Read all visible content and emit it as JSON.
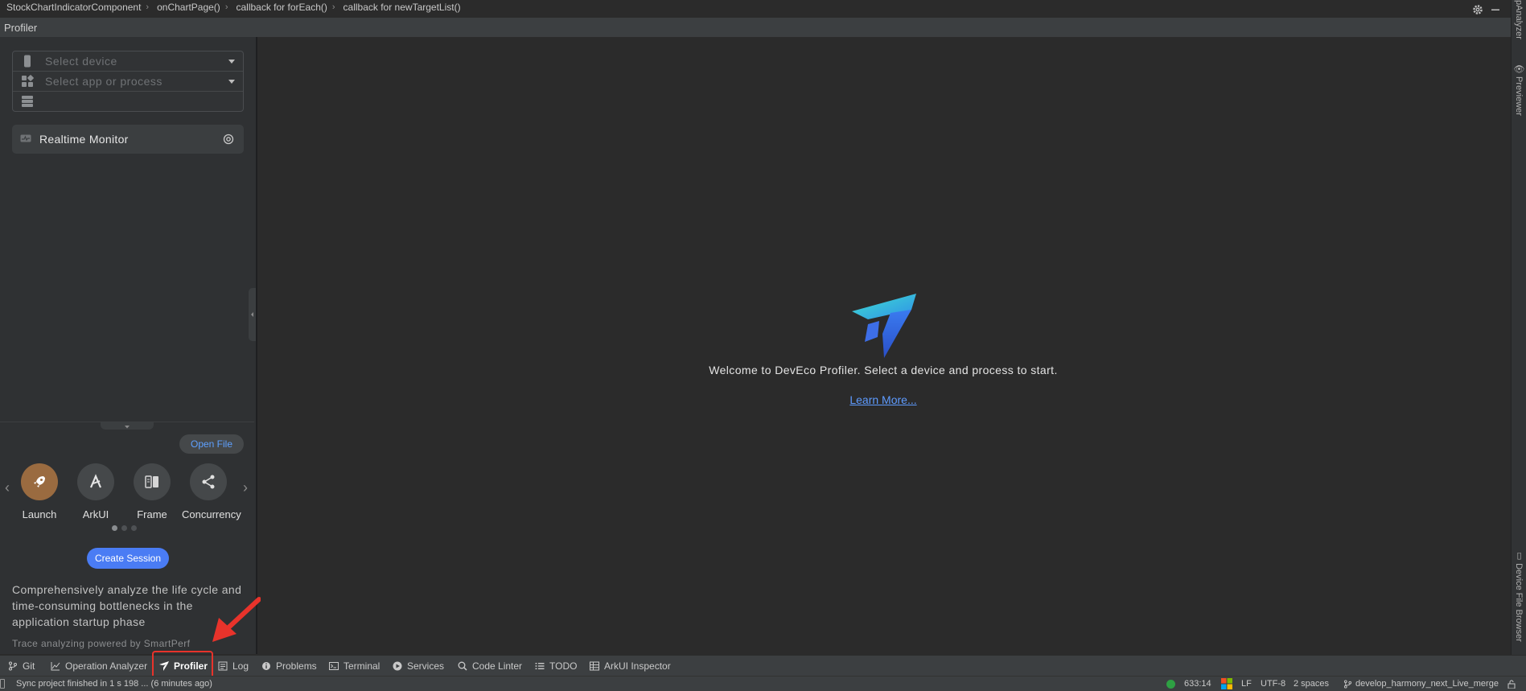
{
  "breadcrumb": [
    "StockChartIndicatorComponent",
    "onChartPage()",
    "callback for forEach()",
    "callback for newTargetList()"
  ],
  "toolwindow": {
    "title": "Profiler"
  },
  "selectors": {
    "device_placeholder": "Select device",
    "process_placeholder": "Select app or process"
  },
  "realtime_monitor": "Realtime Monitor",
  "open_file": "Open File",
  "tools": [
    {
      "label": "Launch",
      "icon": "rocket-icon"
    },
    {
      "label": "ArkUI",
      "icon": "arkui-icon"
    },
    {
      "label": "Frame",
      "icon": "frame-icon"
    },
    {
      "label": "Concurrency",
      "icon": "concurrency-icon"
    }
  ],
  "create_session": "Create Session",
  "description": "Comprehensively analyze the life cycle and time-consuming bottlenecks in the application startup phase",
  "powered_by": "Trace analyzing powered by SmartPerf",
  "welcome": {
    "text": "Welcome to DevEco Profiler. Select a device and process to start.",
    "learn_more": "Learn More..."
  },
  "right_stripe": {
    "top_cut": "pAnalyzer",
    "previewer": "Previewer",
    "device_file_browser": "Device File Browser"
  },
  "bottom_tabs": [
    "Git",
    "Operation Analyzer",
    "Profiler",
    "Log",
    "Problems",
    "Terminal",
    "Services",
    "Code Linter",
    "TODO",
    "ArkUI Inspector"
  ],
  "status": {
    "message": "Sync project finished in 1 s 198 ... (6 minutes ago)",
    "position": "633:14",
    "line_sep": "LF",
    "encoding": "UTF-8",
    "indent": "2 spaces",
    "branch": "develop_harmony_next_Live_merge"
  },
  "colors": {
    "accent": "#4a7cf4",
    "link": "#5e9bff",
    "highlight": "#e8332b",
    "launch_circle": "#9a6b40"
  }
}
